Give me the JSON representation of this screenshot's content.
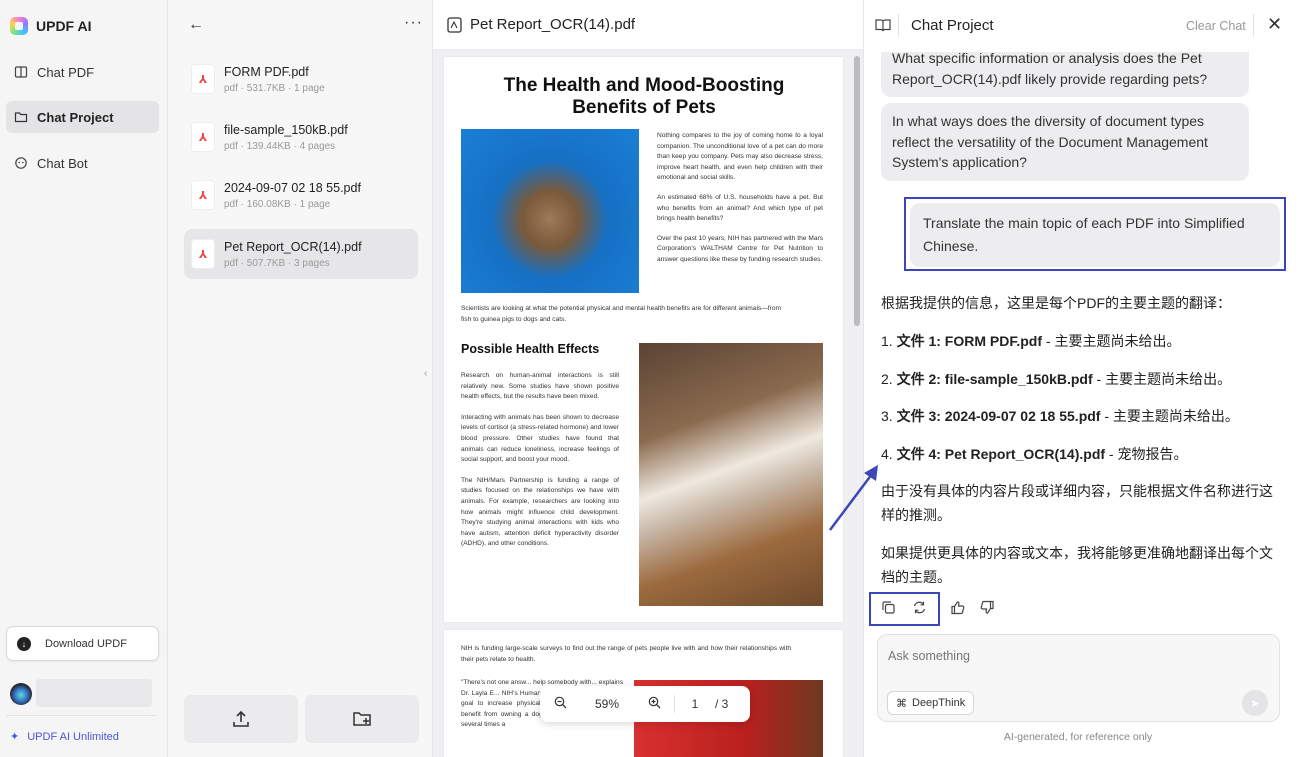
{
  "app": {
    "name": "UPDF AI"
  },
  "nav": {
    "items": [
      {
        "label": "Chat PDF"
      },
      {
        "label": "Chat Project"
      },
      {
        "label": "Chat Bot"
      }
    ],
    "download_label": "Download UPDF",
    "unlimited_label": "UPDF AI Unlimited"
  },
  "files": [
    {
      "name": "FORM PDF.pdf",
      "meta": "pdf · 531.7KB · 1 page"
    },
    {
      "name": "file-sample_150kB.pdf",
      "meta": "pdf · 139.44KB · 4 pages"
    },
    {
      "name": "2024-09-07 02 18 55.pdf",
      "meta": "pdf · 160.08KB · 1 page"
    },
    {
      "name": "Pet Report_OCR(14).pdf",
      "meta": "pdf · 507.7KB · 3 pages"
    }
  ],
  "viewer": {
    "filename": "Pet Report_OCR(14).pdf",
    "doc_title": "The Health and Mood-Boosting Benefits of Pets",
    "p1": "Nothing compares to the joy of coming home to a loyal companion. The unconditional love of a pet can do more than keep you company. Pets may also decrease stress, improve heart health, and even help children with their emotional and social skills.",
    "p2": "An estimated 68% of U.S. households have a pet. But who benefits from an animal? And which type of pet brings health benefits?",
    "p3": "Over the past 10 years, NIH has partnered with the Mars Corporation's WALTHAM Centre for Pet Nutrition to answer questions like these by funding research studies.",
    "p4": "Scientists are looking at what the potential physical and mental health benefits are for different animals—from fish to guinea pigs to dogs and cats.",
    "h2": "Possible Health Effects",
    "p5": "Research on human-animal interactions is still relatively new. Some studies have shown positive health effects, but the results have been mixed.",
    "p6": "Interacting with animals has been shown to decrease levels of cortisol (a stress-related hormone) and lower blood pressure. Other studies have found that animals can reduce loneliness, increase feelings of social support, and boost your mood.",
    "p7": "The NIH/Mars Partnership is funding a range of studies focused on the relationships we have with animals. For example, researchers are looking into how animals might influence child development. They're studying animal interactions with kids who have autism, attention deficit hyperactivity disorder (ADHD), and other conditions.",
    "p8": "NIH is funding large-scale surveys to find out the range of pets people live with and how their relationships with their pets relate to health.",
    "p9": "\"There's not one answ... help somebody with... explains Dr. Layla E... NIH's Human-Animal... Program. \"Is your goal to increase physical activity? Then you might benefit from owning a dog. You have to walk a dog several times a",
    "zoom": "59%",
    "page": "1",
    "total_pages": "/ 3"
  },
  "chat": {
    "title": "Chat Project",
    "clear_label": "Clear Chat",
    "q_partial": "What specific information or analysis does the Pet Report_OCR(14).pdf likely provide regarding pets?",
    "q2": "In what ways does the diversity of document types reflect the versatility of the Document Management System's application?",
    "q3": "Translate the main topic of each PDF into Simplified Chinese.",
    "answer_intro": "根据我提供的信息，这里是每个PDF的主要主题的翻译：",
    "answer_items": [
      {
        "num": "1.",
        "bold": "文件 1: FORM PDF.pdf",
        "rest": " - 主要主题尚未给出。"
      },
      {
        "num": "2.",
        "bold": "文件 2: file-sample_150kB.pdf",
        "rest": " - 主要主题尚未给出。"
      },
      {
        "num": "3.",
        "bold": "文件 3: 2024-09-07 02 18 55.pdf",
        "rest": " - 主要主题尚未给出。"
      },
      {
        "num": "4.",
        "bold": "文件 4: Pet Report_OCR(14).pdf",
        "rest": " - 宠物报告。"
      }
    ],
    "answer_p2": "由于没有具体的内容片段或详细内容，只能根据文件名称进行这样的推测。",
    "answer_p3": "如果提供更具体的内容或文本，我将能够更准确地翻译出每个文档的主题。",
    "input_placeholder": "Ask something",
    "deepthink_label": "DeepThink",
    "footer": "AI-generated, for reference only"
  },
  "colors": {
    "accent": "#3b47b8",
    "link": "#4b57d4"
  }
}
